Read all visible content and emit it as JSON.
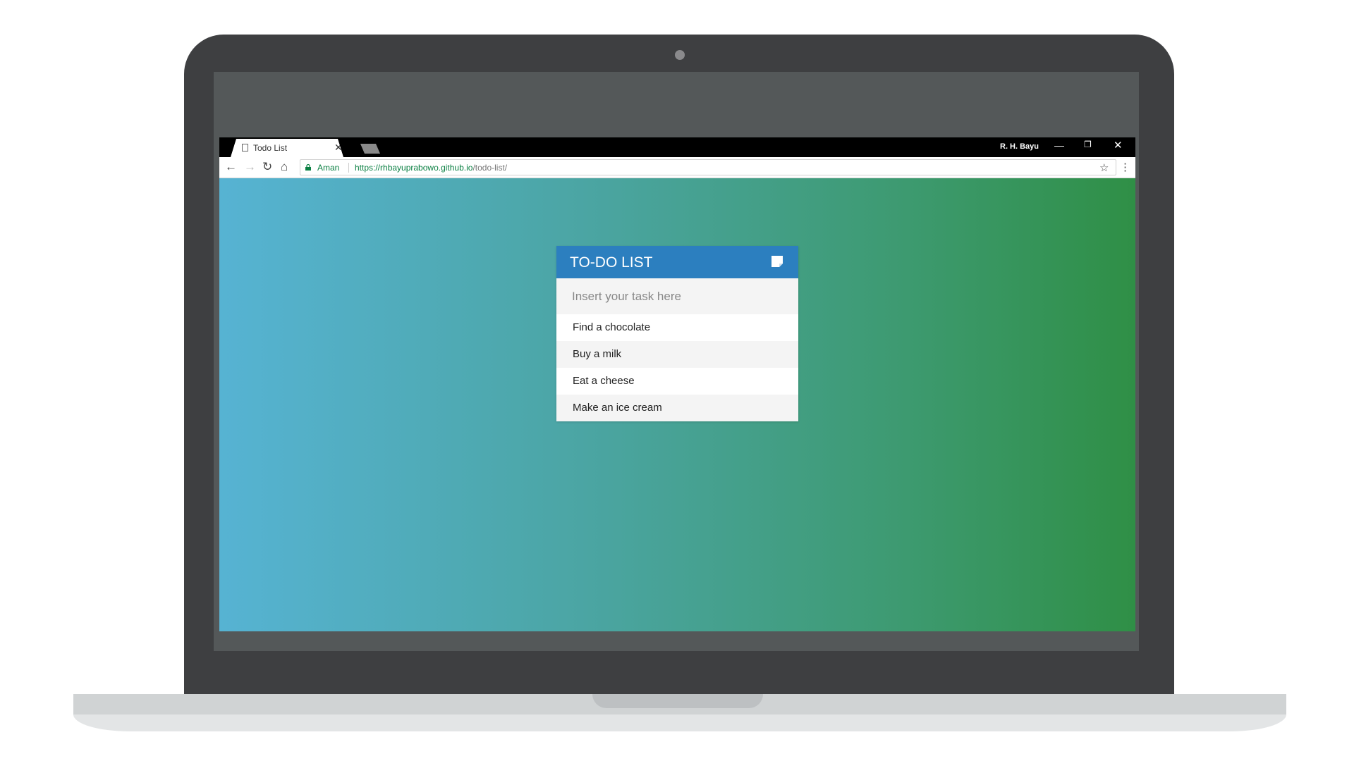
{
  "browser": {
    "tab_title": "Todo List",
    "profile_name": "R. H. Bayu",
    "secure_label": "Aman",
    "url_base": "https://rhbayuprabowo.github.io",
    "url_path": "/todo-list/"
  },
  "todo": {
    "title": "TO-DO LIST",
    "input_placeholder": "Insert your task here",
    "items": [
      {
        "label": "Find a chocolate"
      },
      {
        "label": "Buy a milk"
      },
      {
        "label": "Eat a cheese"
      },
      {
        "label": "Make an ice cream"
      }
    ]
  },
  "colors": {
    "header_blue": "#2c7fbf",
    "gradient_start": "#56b3d3",
    "gradient_end": "#2f8f46",
    "laptop_frame": "#3e3f41"
  },
  "icons": [
    "page-icon",
    "close-icon",
    "back-icon",
    "forward-icon",
    "reload-icon",
    "home-icon",
    "lock-icon",
    "star-icon",
    "menu-icon",
    "note-icon",
    "camera-icon"
  ]
}
